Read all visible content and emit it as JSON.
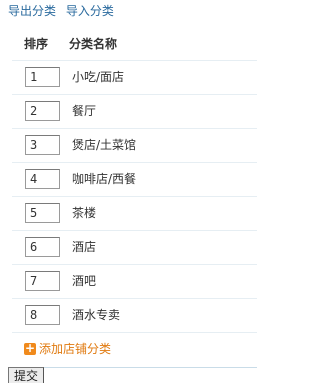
{
  "top_links": {
    "export": "导出分类",
    "import": "导入分类"
  },
  "table": {
    "headers": {
      "order": "排序",
      "name": "分类名称"
    },
    "rows": [
      {
        "order": "1",
        "name": "小吃/面店"
      },
      {
        "order": "2",
        "name": "餐厅"
      },
      {
        "order": "3",
        "name": "煲店/土菜馆"
      },
      {
        "order": "4",
        "name": "咖啡店/西餐"
      },
      {
        "order": "5",
        "name": "茶楼"
      },
      {
        "order": "6",
        "name": "酒店"
      },
      {
        "order": "7",
        "name": "酒吧"
      },
      {
        "order": "8",
        "name": "酒水专卖"
      }
    ]
  },
  "add_link": {
    "label": "添加店铺分类",
    "icon": "plus-icon",
    "color": "#e07a10"
  },
  "submit_label": "提交",
  "colors": {
    "link": "#2a6a9e",
    "row_border": "#e6eef3"
  }
}
